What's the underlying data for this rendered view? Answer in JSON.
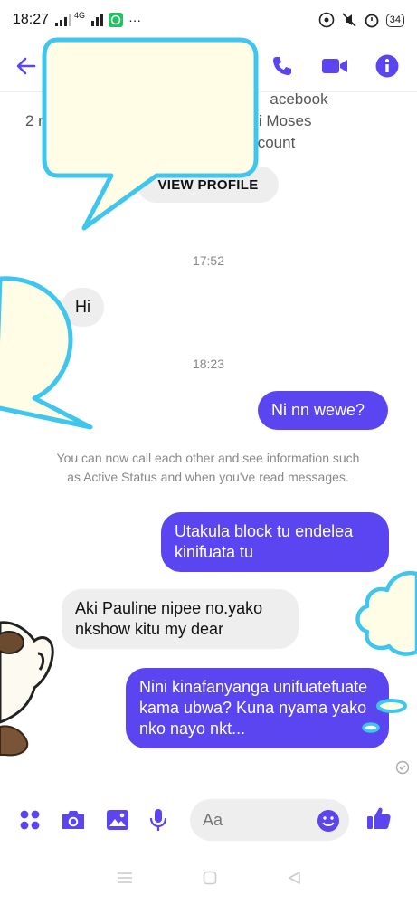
{
  "status_bar": {
    "time": "18:27",
    "network": "4G",
    "more": "···",
    "battery": "34"
  },
  "header": {
    "back_icon": "arrow-left-icon",
    "call_icon": "phone-icon",
    "video_icon": "video-camera-icon",
    "info_icon": "info-icon"
  },
  "profile": {
    "line1": "acebook",
    "line2": "2 r                                 a and Njagi Moses",
    "line3": "count",
    "view_profile_label": "VIEW PROFILE"
  },
  "conversation": {
    "time1": "17:52",
    "msg_hi": "Hi",
    "time2": "18:23",
    "msg_out1": "Ni nn wewe?",
    "system_note": "You can now call each other and see information such as Active Status and when you've read messages.",
    "msg_out2": "Utakula block tu endelea kinifuata tu",
    "msg_in2": "Aki Pauline nipee no.yako nkshow kitu my dear",
    "msg_out3": "Nini kinafanyanga unifuatefuate kama ubwa? Kuna nyama yako nko nayo nkt..."
  },
  "composer": {
    "placeholder": "Aa",
    "menu_icon": "four-dots-icon",
    "camera_icon": "camera-icon",
    "gallery_icon": "image-icon",
    "mic_icon": "microphone-icon",
    "emoji_icon": "smiley-icon",
    "like_icon": "thumbs-up-icon"
  },
  "colors": {
    "accent": "#5a45f0",
    "overlay_fill": "#fffde6",
    "overlay_stroke": "#3ec6ef"
  }
}
